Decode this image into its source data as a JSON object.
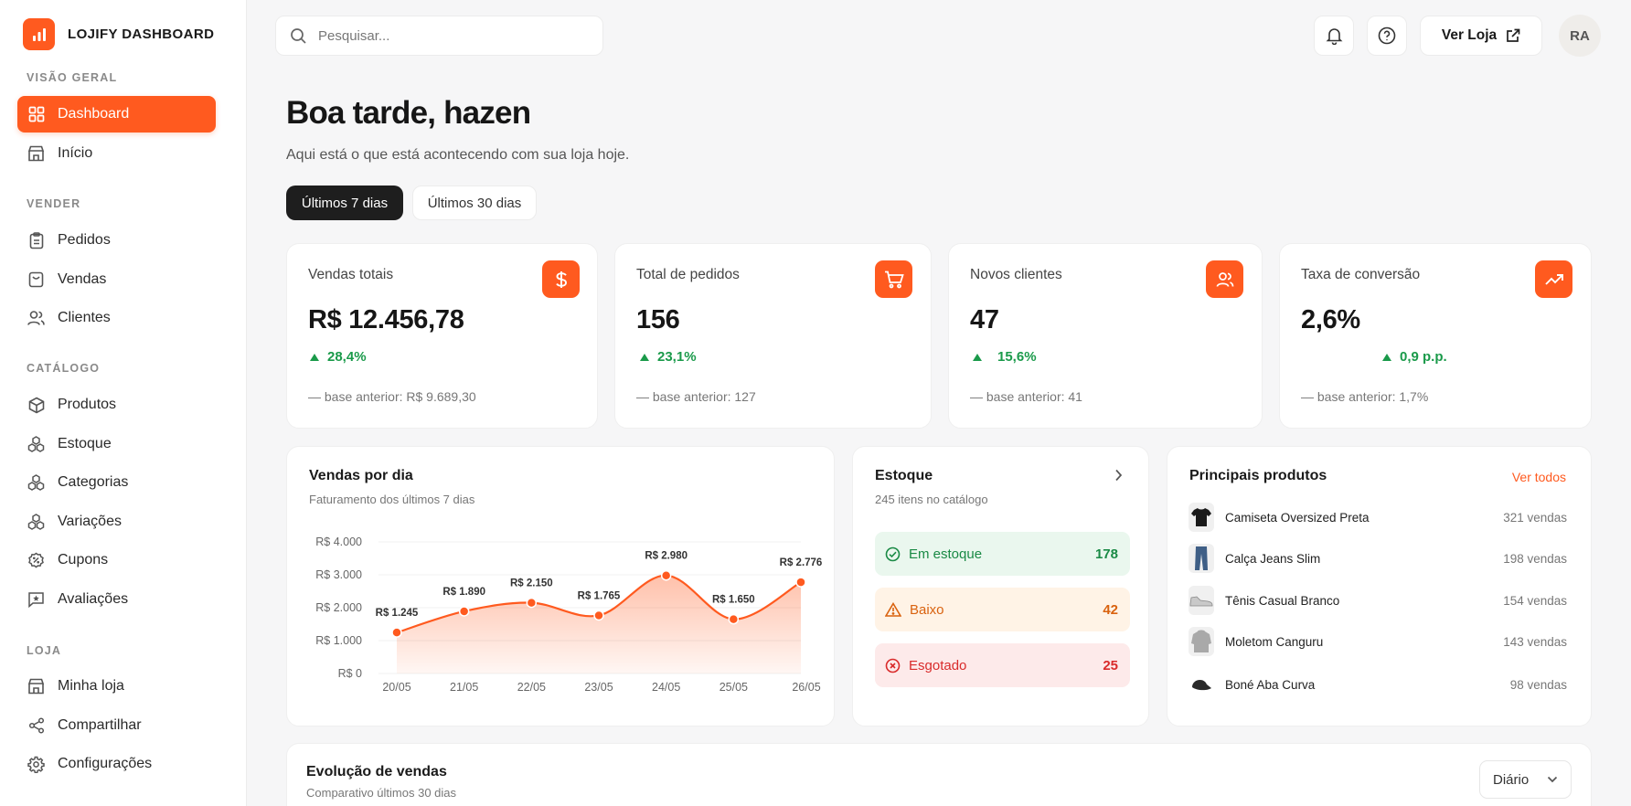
{
  "brand": {
    "name": "LOJIFY DASHBOARD",
    "accent": "#ff5a1f"
  },
  "sidebar": {
    "sections": [
      {
        "title": "VISÃO GERAL",
        "items": [
          {
            "label": "Dashboard",
            "icon": "grid-icon",
            "active": true
          },
          {
            "label": "Início",
            "icon": "store-icon"
          }
        ]
      },
      {
        "title": "VENDER",
        "items": [
          {
            "label": "Pedidos",
            "icon": "clipboard-icon"
          },
          {
            "label": "Vendas",
            "icon": "shopping-bag-icon"
          },
          {
            "label": "Clientes",
            "icon": "users-icon"
          }
        ]
      },
      {
        "title": "CATÁLOGO",
        "items": [
          {
            "label": "Produtos",
            "icon": "box-icon"
          },
          {
            "label": "Estoque",
            "icon": "boxes-icon"
          },
          {
            "label": "Categorias",
            "icon": "boxes-icon"
          },
          {
            "label": "Variações",
            "icon": "boxes-icon"
          },
          {
            "label": "Cupons",
            "icon": "badge-percent-icon"
          },
          {
            "label": "Avaliações",
            "icon": "message-star-icon"
          }
        ]
      },
      {
        "title": "LOJA",
        "items": [
          {
            "label": "Minha loja",
            "icon": "store-icon"
          },
          {
            "label": "Compartilhar",
            "icon": "share-icon"
          },
          {
            "label": "Configurações",
            "icon": "gear-icon"
          }
        ]
      }
    ]
  },
  "topbar": {
    "search_placeholder": "Pesquisar...",
    "store_button": "Ver Loja",
    "avatar_initials": "RA"
  },
  "header": {
    "greeting": "Boa tarde, hazen",
    "subtitle": "Aqui está o que está acontecendo com sua loja hoje.",
    "periods": [
      "Últimos 7 dias",
      "Últimos 30 dias"
    ]
  },
  "kpis": [
    {
      "label": "Vendas totais",
      "value": "R$ 12.456,78",
      "delta": "28,4%",
      "base": "— base anterior: R$ 9.689,30",
      "icon": "dollar-icon"
    },
    {
      "label": "Total de pedidos",
      "value": "156",
      "delta": "23,1%",
      "base": "— base anterior: 127",
      "icon": "cart-icon"
    },
    {
      "label": "Novos clientes",
      "value": "47",
      "delta": "15,6%",
      "base": "— base anterior: 41",
      "icon": "users-icon"
    },
    {
      "label": "Taxa de conversão",
      "value": "2,6%",
      "delta": "0,9 p.p.",
      "base": "— base anterior: 1,7%",
      "icon": "trend-up-icon"
    }
  ],
  "sales_chart": {
    "title": "Vendas por dia",
    "subtitle": "Faturamento dos últimos 7 dias"
  },
  "chart_data": {
    "type": "area",
    "x": [
      "20/05",
      "21/05",
      "22/05",
      "23/05",
      "24/05",
      "25/05",
      "26/05"
    ],
    "values": [
      1245,
      1890,
      2150,
      1765,
      2980,
      1650,
      2776
    ],
    "data_labels": [
      "R$ 1.245",
      "R$ 1.890",
      "R$ 2.150",
      "R$ 1.765",
      "R$ 2.980",
      "R$ 1.650",
      "R$ 2.776"
    ],
    "y_ticks": [
      "R$ 4.000",
      "R$ 3.000",
      "R$ 2.000",
      "R$ 1.000",
      "R$ 0"
    ],
    "ylim": [
      0,
      4000
    ],
    "line_color": "#ff5a1f",
    "grid": true
  },
  "stock": {
    "title": "Estoque",
    "subtitle": "245 itens no catálogo",
    "rows": [
      {
        "label": "Em estoque",
        "count": "178",
        "bg": "#eaf7ee",
        "color": "#1a8a45",
        "icon": "check-circle-icon"
      },
      {
        "label": "Baixo",
        "count": "42",
        "bg": "#fff3e6",
        "color": "#d9620f",
        "icon": "warning-icon"
      },
      {
        "label": "Esgotado",
        "count": "25",
        "bg": "#fdeaea",
        "color": "#d92b2b",
        "icon": "x-circle-icon"
      }
    ]
  },
  "top_products": {
    "title": "Principais produtos",
    "link": "Ver todos",
    "items": [
      {
        "name": "Camiseta Oversized Preta",
        "sales": "321 vendas",
        "icon": "tshirt-icon"
      },
      {
        "name": "Calça Jeans Slim",
        "sales": "198 vendas",
        "icon": "pants-icon"
      },
      {
        "name": "Tênis Casual Branco",
        "sales": "154 vendas",
        "icon": "sneaker-icon"
      },
      {
        "name": "Moletom Canguru",
        "sales": "143 vendas",
        "icon": "hoodie-icon"
      },
      {
        "name": "Boné Aba Curva",
        "sales": "98 vendas",
        "icon": "cap-icon"
      }
    ]
  },
  "evolution": {
    "title": "Evolução de vendas",
    "subtitle": "Comparativo últimos 30 dias",
    "select_value": "Diário"
  }
}
